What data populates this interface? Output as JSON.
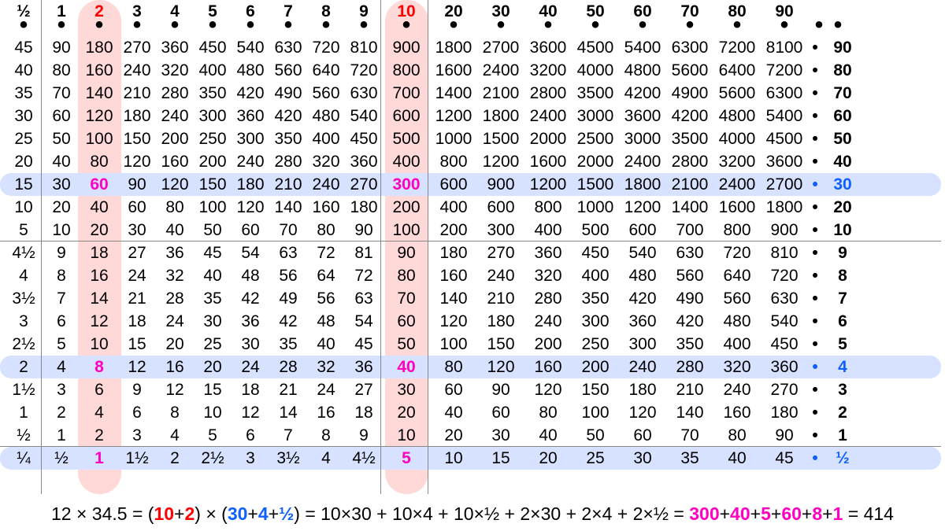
{
  "chart_data": {
    "type": "table",
    "title": "Multiplication lookup table with worked example 12 × 34.5",
    "col_headers": [
      "½",
      "1",
      "2",
      "3",
      "4",
      "5",
      "6",
      "7",
      "8",
      "9",
      "10",
      "20",
      "30",
      "40",
      "50",
      "60",
      "70",
      "80",
      "90"
    ],
    "row_labels": [
      "90",
      "80",
      "70",
      "60",
      "50",
      "40",
      "30",
      "20",
      "10",
      "9",
      "8",
      "7",
      "6",
      "5",
      "4",
      "3",
      "2",
      "1",
      "½"
    ],
    "cells": [
      [
        "45",
        "90",
        "180",
        "270",
        "360",
        "450",
        "540",
        "630",
        "720",
        "810",
        "900",
        "1800",
        "2700",
        "3600",
        "4500",
        "5400",
        "6300",
        "7200",
        "8100"
      ],
      [
        "40",
        "80",
        "160",
        "240",
        "320",
        "400",
        "480",
        "560",
        "640",
        "720",
        "800",
        "1600",
        "2400",
        "3200",
        "4000",
        "4800",
        "5600",
        "6400",
        "7200"
      ],
      [
        "35",
        "70",
        "140",
        "210",
        "280",
        "350",
        "420",
        "490",
        "560",
        "630",
        "700",
        "1400",
        "2100",
        "2800",
        "3500",
        "4200",
        "4900",
        "5600",
        "6300"
      ],
      [
        "30",
        "60",
        "120",
        "180",
        "240",
        "300",
        "360",
        "420",
        "480",
        "540",
        "600",
        "1200",
        "1800",
        "2400",
        "3000",
        "3600",
        "4200",
        "4800",
        "5400"
      ],
      [
        "25",
        "50",
        "100",
        "150",
        "200",
        "250",
        "300",
        "350",
        "400",
        "450",
        "500",
        "1000",
        "1500",
        "2000",
        "2500",
        "3000",
        "3500",
        "4000",
        "4500"
      ],
      [
        "20",
        "40",
        "80",
        "120",
        "160",
        "200",
        "240",
        "280",
        "320",
        "360",
        "400",
        "800",
        "1200",
        "1600",
        "2000",
        "2400",
        "2800",
        "3200",
        "3600"
      ],
      [
        "15",
        "30",
        "60",
        "90",
        "120",
        "150",
        "180",
        "210",
        "240",
        "270",
        "300",
        "600",
        "900",
        "1200",
        "1500",
        "1800",
        "2100",
        "2400",
        "2700"
      ],
      [
        "10",
        "20",
        "40",
        "60",
        "80",
        "100",
        "120",
        "140",
        "160",
        "180",
        "200",
        "400",
        "600",
        "800",
        "1000",
        "1200",
        "1400",
        "1600",
        "1800"
      ],
      [
        "5",
        "10",
        "20",
        "30",
        "40",
        "50",
        "60",
        "70",
        "80",
        "90",
        "100",
        "200",
        "300",
        "400",
        "500",
        "600",
        "700",
        "800",
        "900"
      ],
      [
        "4½",
        "9",
        "18",
        "27",
        "36",
        "45",
        "54",
        "63",
        "72",
        "81",
        "90",
        "180",
        "270",
        "360",
        "450",
        "540",
        "630",
        "720",
        "810"
      ],
      [
        "4",
        "8",
        "16",
        "24",
        "32",
        "40",
        "48",
        "56",
        "64",
        "72",
        "80",
        "160",
        "240",
        "320",
        "400",
        "480",
        "560",
        "640",
        "720"
      ],
      [
        "3½",
        "7",
        "14",
        "21",
        "28",
        "35",
        "42",
        "49",
        "56",
        "63",
        "70",
        "140",
        "210",
        "280",
        "350",
        "420",
        "490",
        "560",
        "630"
      ],
      [
        "3",
        "6",
        "12",
        "18",
        "24",
        "30",
        "36",
        "42",
        "48",
        "54",
        "60",
        "120",
        "180",
        "240",
        "300",
        "360",
        "420",
        "480",
        "540"
      ],
      [
        "2½",
        "5",
        "10",
        "15",
        "20",
        "25",
        "30",
        "35",
        "40",
        "45",
        "50",
        "100",
        "150",
        "200",
        "250",
        "300",
        "350",
        "400",
        "450"
      ],
      [
        "2",
        "4",
        "8",
        "12",
        "16",
        "20",
        "24",
        "28",
        "32",
        "36",
        "40",
        "80",
        "120",
        "160",
        "200",
        "240",
        "280",
        "320",
        "360"
      ],
      [
        "1½",
        "3",
        "6",
        "9",
        "12",
        "15",
        "18",
        "21",
        "24",
        "27",
        "30",
        "60",
        "90",
        "120",
        "150",
        "180",
        "210",
        "240",
        "270"
      ],
      [
        "1",
        "2",
        "4",
        "6",
        "8",
        "10",
        "12",
        "14",
        "16",
        "18",
        "20",
        "40",
        "60",
        "80",
        "100",
        "120",
        "140",
        "160",
        "180"
      ],
      [
        "½",
        "1",
        "2",
        "3",
        "4",
        "5",
        "6",
        "7",
        "8",
        "9",
        "10",
        "20",
        "30",
        "40",
        "50",
        "60",
        "70",
        "80",
        "90"
      ],
      [
        "¼",
        "½",
        "1",
        "1½",
        "2",
        "2½",
        "3",
        "3½",
        "4",
        "4½",
        "5",
        "10",
        "15",
        "20",
        "25",
        "30",
        "35",
        "40",
        "45"
      ]
    ],
    "highlight_columns_idx": [
      2,
      10
    ],
    "highlight_rows_idx": [
      6,
      14,
      18
    ],
    "magenta_cells_rc": [
      [
        6,
        2
      ],
      [
        6,
        10
      ],
      [
        14,
        2
      ],
      [
        14,
        10
      ],
      [
        18,
        2
      ],
      [
        18,
        10
      ]
    ]
  },
  "eq": {
    "pre1": "12 × 34.5 = (",
    "c10": "10",
    "plus": "+",
    "c2": "2",
    "mid1": ") × (",
    "c30": "30",
    "c4": "4",
    "ch": "½",
    "mid2": ") = 10×30 + 10×4 + 10×½ + 2×30 + 2×4 + 2×½ = ",
    "p300": "300",
    "p40": "40",
    "p5": "5",
    "p60": "60",
    "p8": "8",
    "p1": "1",
    "end": " = 414"
  }
}
